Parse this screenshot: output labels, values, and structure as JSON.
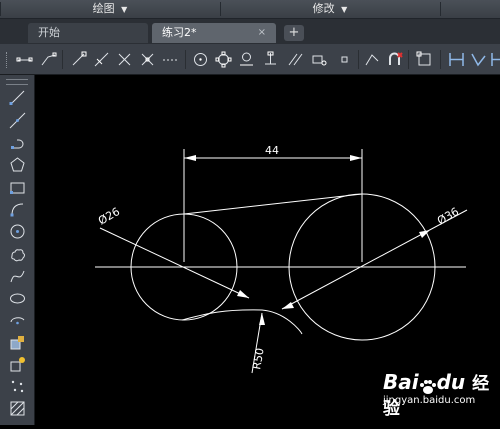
{
  "menubar": {
    "items": [
      {
        "label": "绘图",
        "arrow": "▼"
      },
      {
        "label": "修改",
        "arrow": "▼"
      }
    ]
  },
  "tabs": {
    "start_label": "开始",
    "active_label": "练习2*",
    "close_glyph": "×",
    "add_glyph": "+"
  },
  "toolbar": {
    "icons": [
      "point-line-icon",
      "polyline-icon",
      "line-endpoint-icon",
      "construction-line-icon",
      "cross-icon",
      "cross-small-icon",
      "dashed-line-icon",
      "circle-center-icon",
      "ellipse-node-icon",
      "midpoint-icon",
      "dimension-icon",
      "parallel-icon",
      "block-icon",
      "small-square-icon",
      "snap-off-icon",
      "magnet-icon",
      "viewport-icon",
      "linear-dim-icon",
      "aligned-dim-icon",
      "rotate-dim-icon"
    ]
  },
  "left_toolbar": {
    "icons": [
      "line-icon",
      "construction-line-icon",
      "polyline-icon",
      "polygon-icon",
      "rectangle-icon",
      "arc-icon",
      "circle-icon",
      "revcloud-icon",
      "spline-icon",
      "ellipse-icon",
      "ellipse-arc-icon",
      "insert-block-icon",
      "make-block-icon",
      "point-icon",
      "hatch-icon"
    ]
  },
  "drawing": {
    "dim_distance": "44",
    "dim_diameter_small": "Ø26",
    "dim_diameter_large": "Ø36",
    "dim_radius": "R50",
    "line_color": "#ffffff"
  },
  "watermark": {
    "brand": "Bai",
    "brand2": "du",
    "cn": "经验",
    "url": "jingyan.baidu.com"
  }
}
